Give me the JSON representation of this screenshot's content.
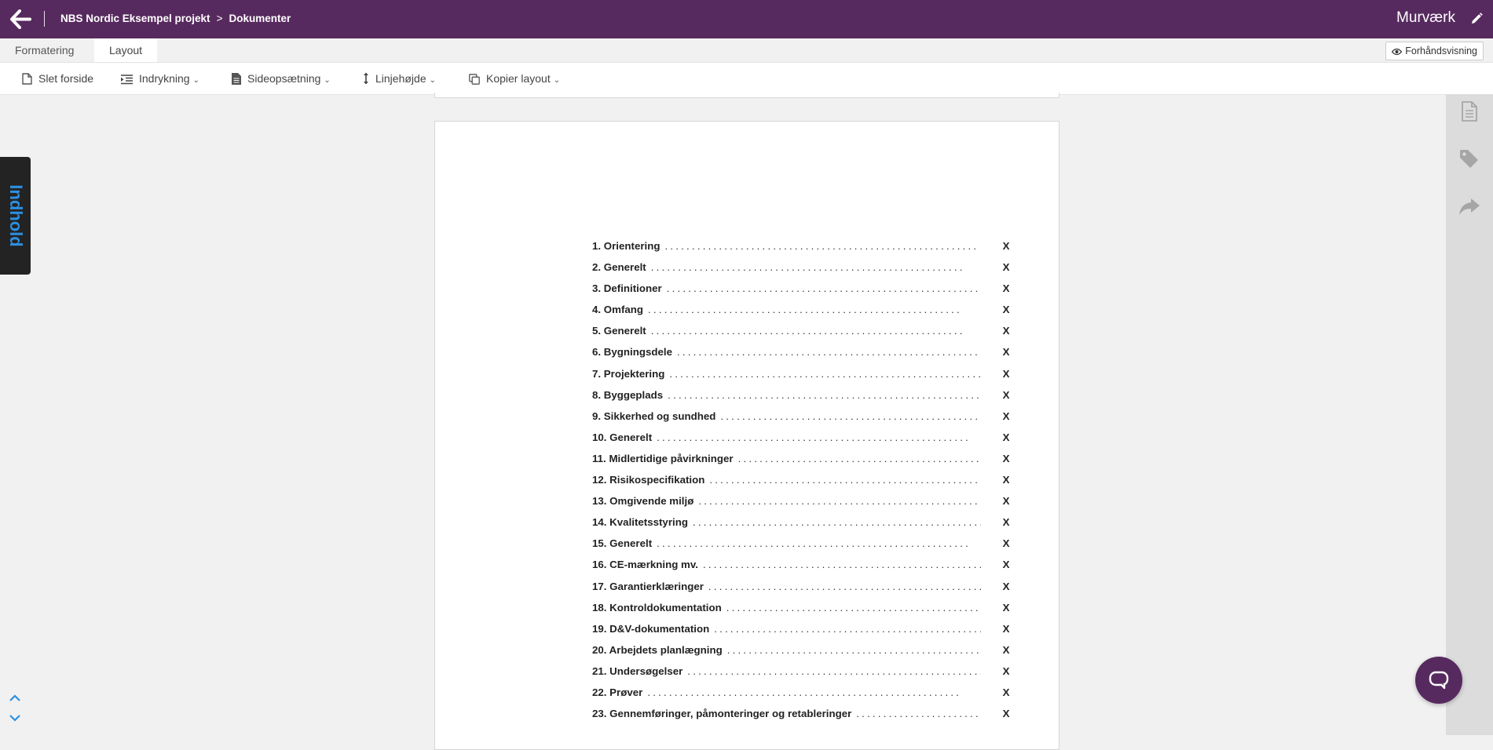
{
  "header": {
    "breadcrumb": [
      "NBS Nordic Eksempel projekt",
      "Dokumenter"
    ],
    "breadcrumb_separator": ">",
    "title": "Murværk",
    "background_color": "#572a5f",
    "icons": {
      "back": "arrow-left-icon",
      "edit": "pencil-icon"
    }
  },
  "tabs": [
    {
      "label": "Formatering",
      "active": false
    },
    {
      "label": "Layout",
      "active": true
    }
  ],
  "preview_label": "Forhåndsvisning",
  "toolbar": [
    {
      "label": "Slet forside",
      "icon": "document-icon",
      "dropdown": false
    },
    {
      "label": "Indrykning",
      "icon": "indent-icon",
      "dropdown": true
    },
    {
      "label": "Sideopsætning",
      "icon": "page-setup-icon",
      "dropdown": true
    },
    {
      "label": "Linjehøjde",
      "icon": "line-height-icon",
      "dropdown": true
    },
    {
      "label": "Kopier layout",
      "icon": "copy-icon",
      "dropdown": true
    }
  ],
  "side_tab": {
    "label": "Indhold",
    "color": "#2d8fe0"
  },
  "toc": [
    {
      "label": "1. Orientering",
      "page": "X"
    },
    {
      "label": "2. Generelt",
      "page": "X"
    },
    {
      "label": "3. Definitioner",
      "page": "X"
    },
    {
      "label": "4. Omfang",
      "page": "X"
    },
    {
      "label": "5. Generelt",
      "page": "X"
    },
    {
      "label": "6. Bygningsdele",
      "page": "X"
    },
    {
      "label": "7. Projektering",
      "page": "X"
    },
    {
      "label": "8. Byggeplads",
      "page": "X"
    },
    {
      "label": "9. Sikkerhed og sundhed",
      "page": "X"
    },
    {
      "label": "10. Generelt",
      "page": "X"
    },
    {
      "label": "11. Midlertidige påvirkninger",
      "page": "X"
    },
    {
      "label": "12. Risikospecifikation",
      "page": "X"
    },
    {
      "label": "13. Omgivende miljø",
      "page": "X"
    },
    {
      "label": "14. Kvalitetsstyring",
      "page": "X"
    },
    {
      "label": "15. Generelt",
      "page": "X"
    },
    {
      "label": "16. CE-mærkning mv.",
      "page": "X"
    },
    {
      "label": "17. Garantierklæringer",
      "page": "X"
    },
    {
      "label": "18. Kontroldokumentation",
      "page": "X"
    },
    {
      "label": "19. D&V-dokumentation",
      "page": "X"
    },
    {
      "label": "20. Arbejdets planlægning",
      "page": "X"
    },
    {
      "label": "21. Undersøgelser",
      "page": "X"
    },
    {
      "label": "22. Prøver",
      "page": "X"
    },
    {
      "label": "23. Gennemføringer, påmonteringer og retableringer",
      "page": "X"
    }
  ],
  "right_rail_icons": [
    "document-lines-icon",
    "tag-icon",
    "share-arrow-icon"
  ],
  "nav_icons": [
    "chevron-up-icon",
    "chevron-down-icon"
  ],
  "chat_icon": "chat-bubble-icon"
}
